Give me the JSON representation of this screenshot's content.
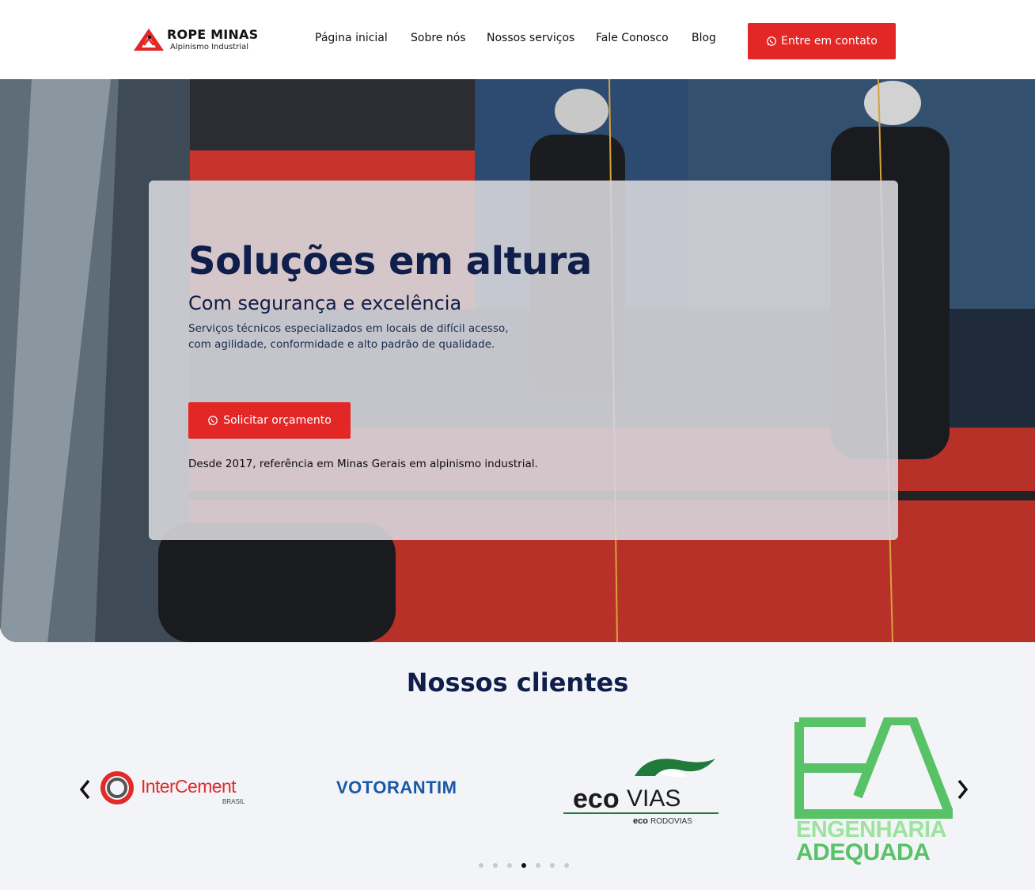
{
  "header": {
    "brand": "ROPE MINAS",
    "brand_sub": "Alpinismo Industrial",
    "nav": [
      "Página inicial",
      "Sobre nós",
      "Nossos serviços",
      "Fale Conosco",
      "Blog"
    ],
    "cta_label": "Entre em contato",
    "cta_icon": "whatsapp-icon",
    "accent": "#e32626"
  },
  "hero": {
    "title": "Soluções em altura",
    "subtitle": "Com segurança e excelência",
    "lead": "Serviços técnicos especializados em locais de difícil acesso, com agilidade, conformidade e alto padrão de qualidade.",
    "cta_label": "Solicitar orçamento",
    "since": "Desde 2017, referência em Minas Gerais em alpinismo industrial."
  },
  "clients": {
    "title": "Nossos clientes",
    "logos": [
      {
        "name": "InterCement",
        "sub": "BRASIL"
      },
      {
        "name": "VOTORANTIM"
      },
      {
        "name_a": "eco",
        "name_b": "VIAS",
        "sub_a": "eco",
        "sub_b": "RODOVIAS"
      },
      {
        "mark": "EA",
        "line1": "ENGENHARIA",
        "line2": "ADEQUADA"
      }
    ],
    "prev_icon": "chevron-left-icon",
    "next_icon": "chevron-right-icon",
    "dots_total": 7,
    "dots_active": 4
  }
}
